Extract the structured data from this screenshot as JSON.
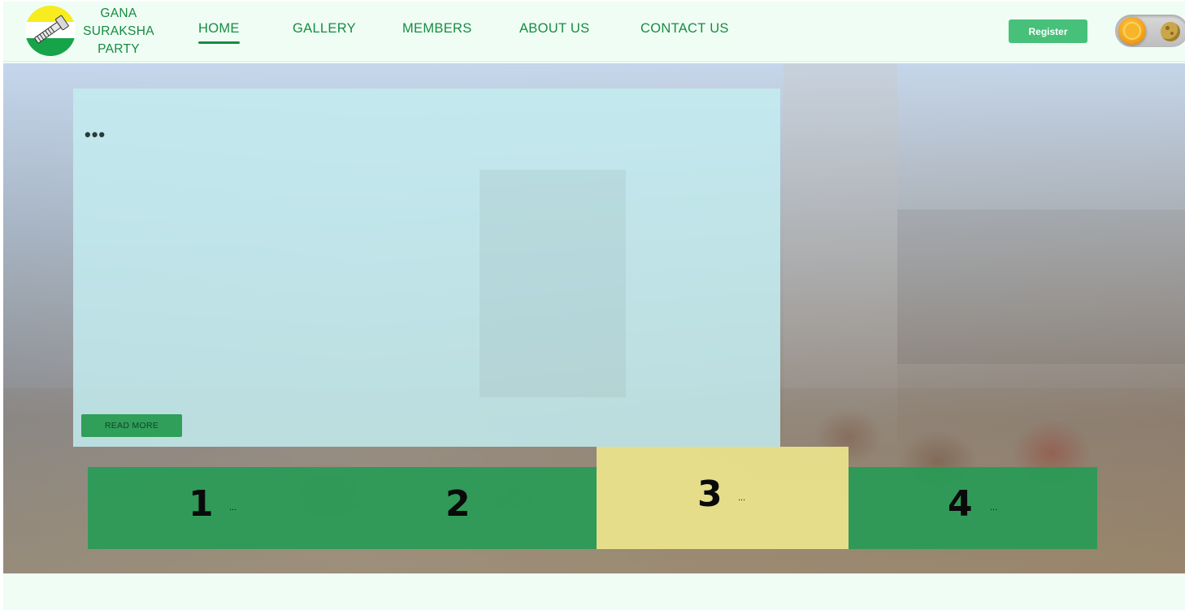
{
  "brand": {
    "lines": [
      "GANA",
      "SURAKSHA",
      "PARTY"
    ],
    "logo_icon": "bolt-flag-logo",
    "colors": {
      "yellow": "#f6ec1e",
      "white": "#ffffff",
      "green": "#17a34a"
    }
  },
  "nav": {
    "items": [
      {
        "label": "HOME",
        "active": true
      },
      {
        "label": "GALLERY",
        "active": false
      },
      {
        "label": "MEMBERS",
        "active": false
      },
      {
        "label": "ABOUT US",
        "active": false
      },
      {
        "label": "CONTACT US",
        "active": false
      }
    ]
  },
  "header": {
    "register_label": "Register",
    "theme_toggle": {
      "sun_icon": "sun-icon",
      "moon_icon": "moon-icon"
    }
  },
  "hero": {
    "slide": {
      "title": "•••",
      "read_more_label": "READ MORE"
    },
    "tabs": [
      {
        "number": "1",
        "text": "..."
      },
      {
        "number": "2",
        "text": ""
      },
      {
        "number": "3",
        "text": "...",
        "active": true
      },
      {
        "number": "4",
        "text": "..."
      }
    ]
  },
  "theme": {
    "accent": "#178c42",
    "button_green": "#47c07a",
    "tab_green": "#269b55",
    "tab_active": "#ece48c",
    "page_bg": "#effdf4"
  }
}
